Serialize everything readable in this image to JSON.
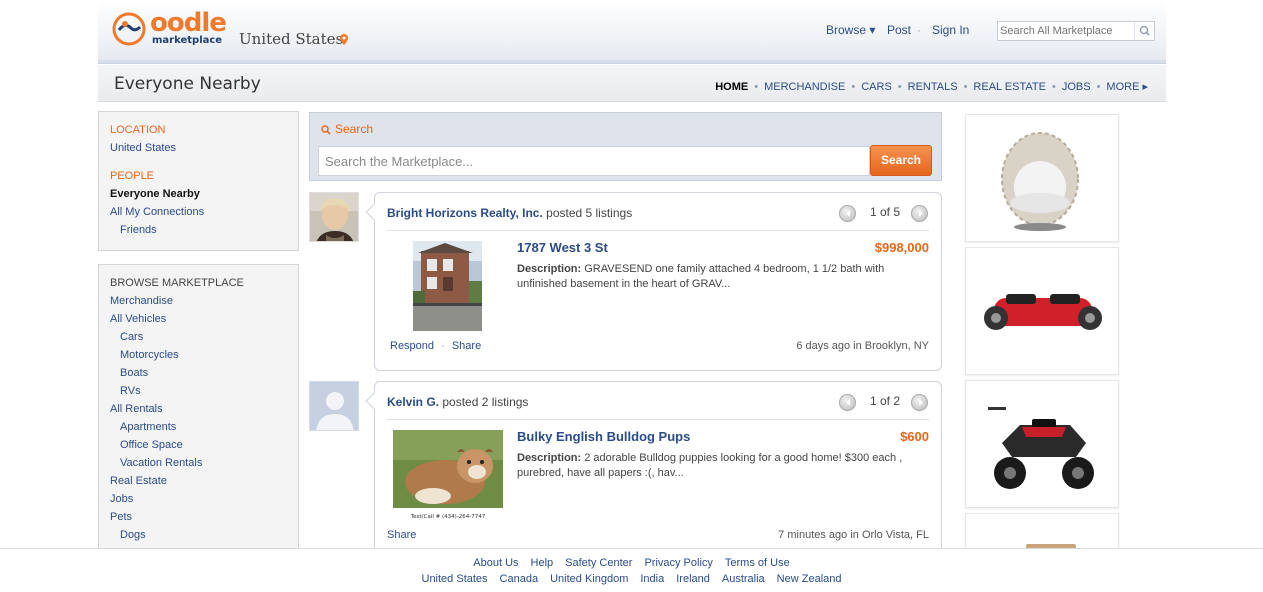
{
  "header": {
    "logo_text": "oodle",
    "logo_sub": "marketplace",
    "country": "United States",
    "nav": {
      "browse": "Browse ▾",
      "post": "Post",
      "sign_in": "Sign In"
    },
    "search_placeholder": "Search All Marketplace"
  },
  "subheader": {
    "title": "Everyone Nearby",
    "categories": [
      "HOME",
      "MERCHANDISE",
      "CARS",
      "RENTALS",
      "REAL ESTATE",
      "JOBS",
      "MORE ▸"
    ]
  },
  "sidebar": {
    "location_label": "LOCATION",
    "location_value": "United States",
    "people_label": "PEOPLE",
    "people": [
      "Everyone Nearby",
      "All My Connections",
      "Friends"
    ],
    "browse_label": "BROWSE MARKETPLACE",
    "browse": [
      "Merchandise",
      "All Vehicles",
      "Cars",
      "Motorcycles",
      "Boats",
      "RVs",
      "All Rentals",
      "Apartments",
      "Office Space",
      "Vacation Rentals",
      "Real Estate",
      "Jobs",
      "Pets",
      "Dogs"
    ]
  },
  "search": {
    "title": "Search",
    "placeholder": "Search the Marketplace...",
    "button": "Search"
  },
  "listings": [
    {
      "poster": "Bright Horizons Realty, Inc.",
      "posted_text": "posted 5 listings",
      "pager": "1 of 5",
      "title": "1787 West 3 St",
      "price": "$998,000",
      "desc_label": "Description:",
      "desc": "GRAVESEND one family attached 4 bedroom, 1 1/2 bath with unfinished basement in the heart of GRAV...",
      "respond": "Respond",
      "share": "Share",
      "meta": "6 days ago in Brooklyn, NY"
    },
    {
      "poster": "Kelvin G.",
      "posted_text": "posted 2 listings",
      "pager": "1 of 2",
      "title": "Bulky English Bulldog Pups",
      "price": "$600",
      "desc_label": "Description:",
      "desc": "2 adorable Bulldog puppies looking for a good home! $300 each , purebred, have all papers :(, hav...",
      "share": "Share",
      "meta": "7 minutes ago in Orlo Vista, FL",
      "thumb_caption": "Text/Call # (434)-264-7747"
    }
  ],
  "footer": {
    "links": [
      "About Us",
      "Help",
      "Safety Center",
      "Privacy Policy",
      "Terms of Use"
    ],
    "countries": [
      "United States",
      "Canada",
      "United Kingdom",
      "India",
      "Ireland",
      "Australia",
      "New Zealand"
    ]
  },
  "colors": {
    "accent": "#e8661a",
    "link": "#2b4c88"
  }
}
